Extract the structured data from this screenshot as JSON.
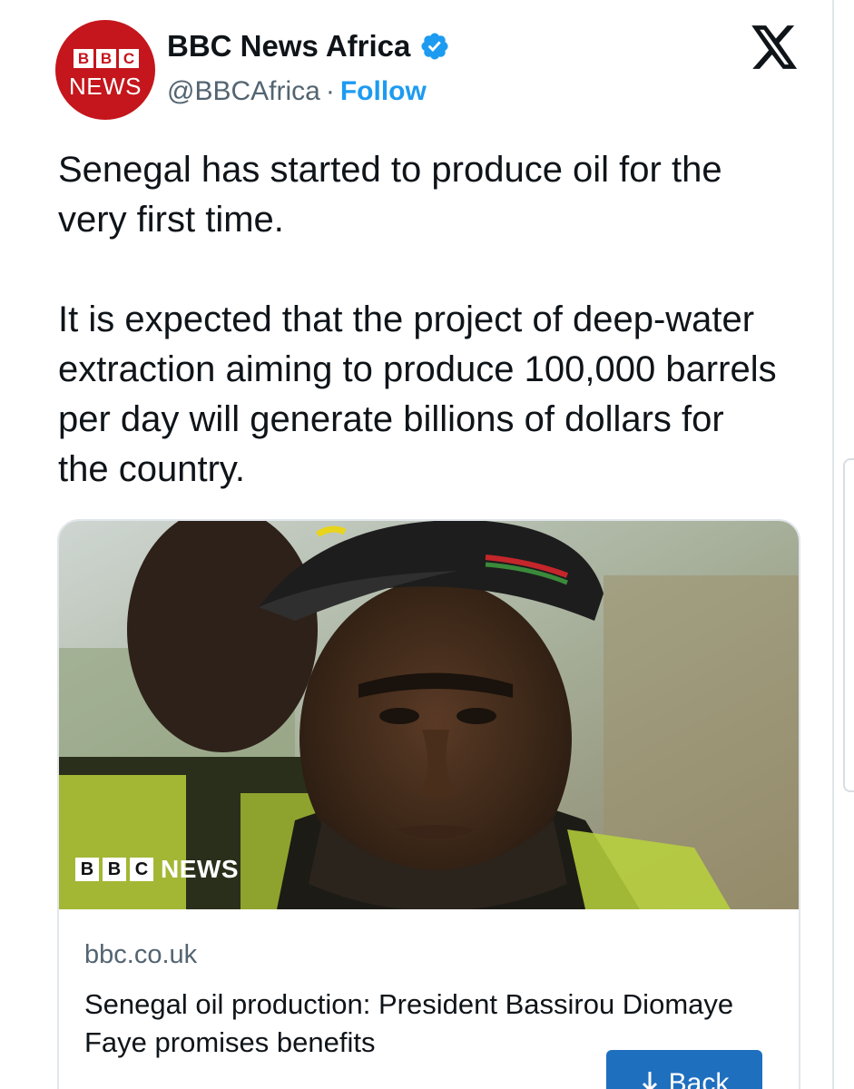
{
  "account": {
    "display_name": "BBC News Africa",
    "handle": "@BBCAfrica",
    "separator": "·",
    "follow_label": "Follow",
    "avatar_blocks": [
      "B",
      "B",
      "C"
    ],
    "avatar_word": "NEWS",
    "verified_icon": "verified-badge-icon",
    "brand_color": "#c4161c"
  },
  "platform": {
    "logo_icon": "x-logo-icon"
  },
  "tweet": {
    "paragraphs": [
      "Senegal has started to produce oil for the very first time.",
      "It is expected that the project of deep-water extraction aiming to produce 100,000 barrels per day will generate billions of dollars for the country."
    ]
  },
  "link_card": {
    "image_badge": {
      "blocks": [
        "B",
        "B",
        "C"
      ],
      "word": "NEWS"
    },
    "domain": "bbc.co.uk",
    "headline": "Senegal oil production: President Bassirou Diomaye Faye promises benefits"
  },
  "back_button": {
    "label": "Back",
    "icon": "arrow-down-icon",
    "color": "#1f6fbf"
  },
  "colors": {
    "accent": "#1d9bf0",
    "text": "#0f1419",
    "muted": "#536471",
    "border": "#e1e6ea"
  }
}
